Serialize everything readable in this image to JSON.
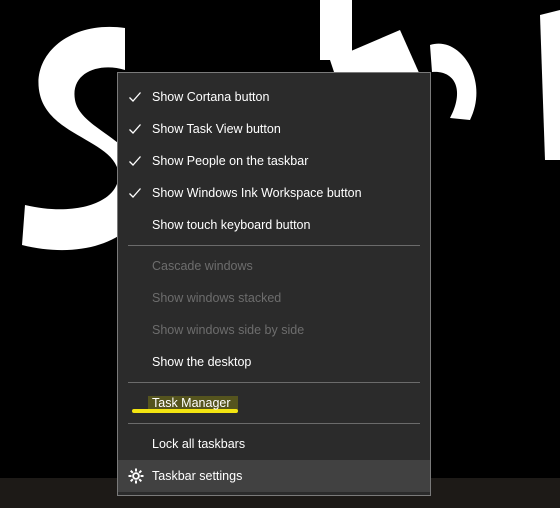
{
  "menu": {
    "group1": [
      {
        "label": "Show Cortana button",
        "checked": true
      },
      {
        "label": "Show Task View button",
        "checked": true
      },
      {
        "label": "Show People on the taskbar",
        "checked": true
      },
      {
        "label": "Show Windows Ink Workspace button",
        "checked": true
      },
      {
        "label": "Show touch keyboard button",
        "checked": false
      }
    ],
    "group2": [
      {
        "label": "Cascade windows",
        "enabled": false
      },
      {
        "label": "Show windows stacked",
        "enabled": false
      },
      {
        "label": "Show windows side by side",
        "enabled": false
      },
      {
        "label": "Show the desktop",
        "enabled": true
      }
    ],
    "task_manager": {
      "label": "Task Manager",
      "highlight_color": "#f2e411"
    },
    "lock_taskbars": {
      "label": "Lock all taskbars",
      "checked": false
    },
    "taskbar_settings": {
      "label": "Taskbar settings",
      "icon": "gear-icon"
    }
  },
  "colors": {
    "menu_bg": "#2b2b2b",
    "menu_border": "#7a7a7a",
    "text": "#ffffff",
    "disabled_text": "#6d6d6d",
    "hover_bg": "#414141",
    "wallpaper_bg": "#000000",
    "wallpaper_art": "#ffffff"
  }
}
